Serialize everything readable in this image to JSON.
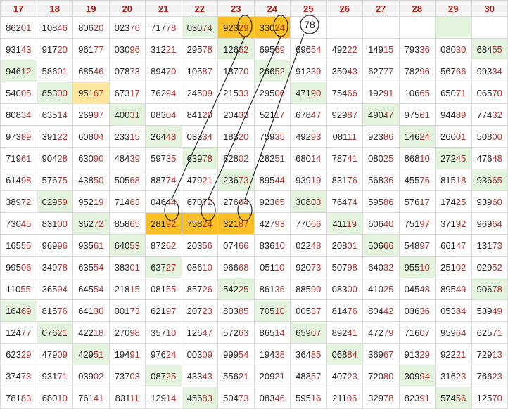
{
  "columns": [
    "17",
    "18",
    "19",
    "20",
    "21",
    "22",
    "23",
    "24",
    "25",
    "26",
    "27",
    "28",
    "29",
    "30"
  ],
  "rows": [
    [
      [
        "86201",
        ""
      ],
      [
        "10846",
        ""
      ],
      [
        "80620",
        ""
      ],
      [
        "02376",
        ""
      ],
      [
        "71778",
        ""
      ],
      [
        "03074",
        "g"
      ],
      [
        "92329",
        "o"
      ],
      [
        "33024",
        "o"
      ],
      [
        "",
        ""
      ],
      [
        "",
        ""
      ],
      [
        "",
        ""
      ],
      [
        "",
        ""
      ],
      [
        "",
        "g"
      ],
      [
        "",
        ""
      ]
    ],
    [
      [
        "93143",
        ""
      ],
      [
        "91720",
        ""
      ],
      [
        "96177",
        ""
      ],
      [
        "03096",
        ""
      ],
      [
        "31221",
        ""
      ],
      [
        "29578",
        ""
      ],
      [
        "12662",
        "g"
      ],
      [
        "69569",
        ""
      ],
      [
        "69654",
        ""
      ],
      [
        "49222",
        ""
      ],
      [
        "14915",
        ""
      ],
      [
        "79336",
        ""
      ],
      [
        "08030",
        ""
      ],
      [
        "68455",
        "g"
      ]
    ],
    [
      [
        "94612",
        "g"
      ],
      [
        "58601",
        ""
      ],
      [
        "68546",
        ""
      ],
      [
        "07873",
        ""
      ],
      [
        "89470",
        ""
      ],
      [
        "10587",
        ""
      ],
      [
        "18770",
        ""
      ],
      [
        "26652",
        "g"
      ],
      [
        "91239",
        ""
      ],
      [
        "35043",
        ""
      ],
      [
        "62777",
        ""
      ],
      [
        "78296",
        ""
      ],
      [
        "56766",
        ""
      ],
      [
        "99334",
        ""
      ]
    ],
    [
      [
        "54005",
        ""
      ],
      [
        "85300",
        "g"
      ],
      [
        "95167",
        "y"
      ],
      [
        "67317",
        ""
      ],
      [
        "76294",
        ""
      ],
      [
        "24509",
        ""
      ],
      [
        "21533",
        ""
      ],
      [
        "29506",
        ""
      ],
      [
        "47190",
        "g"
      ],
      [
        "75466",
        ""
      ],
      [
        "19291",
        ""
      ],
      [
        "10665",
        ""
      ],
      [
        "65071",
        ""
      ],
      [
        "06570",
        ""
      ]
    ],
    [
      [
        "80834",
        ""
      ],
      [
        "63514",
        ""
      ],
      [
        "26997",
        ""
      ],
      [
        "40031",
        "g"
      ],
      [
        "08304",
        ""
      ],
      [
        "84120",
        ""
      ],
      [
        "20433",
        ""
      ],
      [
        "52117",
        ""
      ],
      [
        "67847",
        ""
      ],
      [
        "92987",
        ""
      ],
      [
        "49047",
        "g"
      ],
      [
        "97561",
        ""
      ],
      [
        "94489",
        ""
      ],
      [
        "77432",
        ""
      ]
    ],
    [
      [
        "97389",
        ""
      ],
      [
        "39122",
        ""
      ],
      [
        "60804",
        ""
      ],
      [
        "23315",
        ""
      ],
      [
        "26443",
        "g"
      ],
      [
        "03334",
        ""
      ],
      [
        "18320",
        ""
      ],
      [
        "75935",
        ""
      ],
      [
        "49293",
        ""
      ],
      [
        "08111",
        ""
      ],
      [
        "92386",
        ""
      ],
      [
        "14624",
        "g"
      ],
      [
        "26001",
        ""
      ],
      [
        "50800",
        ""
      ]
    ],
    [
      [
        "71961",
        ""
      ],
      [
        "90428",
        ""
      ],
      [
        "63090",
        ""
      ],
      [
        "48439",
        ""
      ],
      [
        "59735",
        ""
      ],
      [
        "63978",
        "g"
      ],
      [
        "82802",
        ""
      ],
      [
        "28251",
        ""
      ],
      [
        "68014",
        ""
      ],
      [
        "78741",
        ""
      ],
      [
        "08025",
        ""
      ],
      [
        "86810",
        ""
      ],
      [
        "27245",
        "g"
      ],
      [
        "47648",
        ""
      ]
    ],
    [
      [
        "61498",
        ""
      ],
      [
        "57675",
        ""
      ],
      [
        "43850",
        ""
      ],
      [
        "50568",
        ""
      ],
      [
        "88774",
        ""
      ],
      [
        "47921",
        ""
      ],
      [
        "23673",
        "g"
      ],
      [
        "89544",
        ""
      ],
      [
        "93919",
        ""
      ],
      [
        "83176",
        ""
      ],
      [
        "56836",
        ""
      ],
      [
        "45576",
        ""
      ],
      [
        "81518",
        ""
      ],
      [
        "93665",
        "g"
      ]
    ],
    [
      [
        "38972",
        ""
      ],
      [
        "02959",
        "g"
      ],
      [
        "95219",
        ""
      ],
      [
        "71463",
        ""
      ],
      [
        "04644",
        ""
      ],
      [
        "67072",
        ""
      ],
      [
        "27664",
        ""
      ],
      [
        "92365",
        ""
      ],
      [
        "30803",
        "g"
      ],
      [
        "76474",
        ""
      ],
      [
        "59586",
        ""
      ],
      [
        "57617",
        ""
      ],
      [
        "17425",
        ""
      ],
      [
        "93960",
        ""
      ]
    ],
    [
      [
        "73045",
        ""
      ],
      [
        "83100",
        ""
      ],
      [
        "36272",
        "g"
      ],
      [
        "85865",
        ""
      ],
      [
        "28192",
        "o"
      ],
      [
        "75824",
        "o"
      ],
      [
        "32187",
        "o"
      ],
      [
        "42793",
        ""
      ],
      [
        "77066",
        ""
      ],
      [
        "41119",
        "g"
      ],
      [
        "60640",
        ""
      ],
      [
        "75197",
        ""
      ],
      [
        "37192",
        ""
      ],
      [
        "96964",
        ""
      ]
    ],
    [
      [
        "16555",
        ""
      ],
      [
        "96996",
        ""
      ],
      [
        "93561",
        ""
      ],
      [
        "64053",
        "g"
      ],
      [
        "87262",
        ""
      ],
      [
        "20356",
        ""
      ],
      [
        "07466",
        ""
      ],
      [
        "83610",
        ""
      ],
      [
        "02248",
        ""
      ],
      [
        "20801",
        ""
      ],
      [
        "50666",
        "g"
      ],
      [
        "54897",
        ""
      ],
      [
        "66147",
        ""
      ],
      [
        "13173",
        ""
      ]
    ],
    [
      [
        "99506",
        ""
      ],
      [
        "34978",
        ""
      ],
      [
        "63554",
        ""
      ],
      [
        "38301",
        ""
      ],
      [
        "63727",
        "g"
      ],
      [
        "08610",
        ""
      ],
      [
        "96668",
        ""
      ],
      [
        "05110",
        ""
      ],
      [
        "92073",
        ""
      ],
      [
        "50798",
        ""
      ],
      [
        "64032",
        ""
      ],
      [
        "95510",
        "g"
      ],
      [
        "25102",
        ""
      ],
      [
        "02952",
        ""
      ]
    ],
    [
      [
        "11055",
        ""
      ],
      [
        "36594",
        ""
      ],
      [
        "64554",
        ""
      ],
      [
        "21815",
        ""
      ],
      [
        "08155",
        ""
      ],
      [
        "85726",
        ""
      ],
      [
        "54225",
        "g"
      ],
      [
        "86136",
        ""
      ],
      [
        "88590",
        ""
      ],
      [
        "08300",
        ""
      ],
      [
        "41025",
        ""
      ],
      [
        "04548",
        ""
      ],
      [
        "89549",
        ""
      ],
      [
        "90678",
        "g"
      ]
    ],
    [
      [
        "16469",
        "g"
      ],
      [
        "81576",
        ""
      ],
      [
        "64130",
        ""
      ],
      [
        "00173",
        ""
      ],
      [
        "62197",
        ""
      ],
      [
        "20723",
        ""
      ],
      [
        "80385",
        ""
      ],
      [
        "70510",
        "g"
      ],
      [
        "00537",
        ""
      ],
      [
        "81476",
        ""
      ],
      [
        "80442",
        ""
      ],
      [
        "03636",
        ""
      ],
      [
        "05384",
        ""
      ],
      [
        "53949",
        ""
      ]
    ],
    [
      [
        "12477",
        ""
      ],
      [
        "07621",
        "g"
      ],
      [
        "42218",
        ""
      ],
      [
        "27098",
        ""
      ],
      [
        "35710",
        ""
      ],
      [
        "12647",
        ""
      ],
      [
        "57263",
        ""
      ],
      [
        "86514",
        ""
      ],
      [
        "65907",
        "g"
      ],
      [
        "89241",
        ""
      ],
      [
        "47279",
        ""
      ],
      [
        "71607",
        ""
      ],
      [
        "95964",
        ""
      ],
      [
        "62571",
        ""
      ]
    ],
    [
      [
        "62329",
        ""
      ],
      [
        "47909",
        ""
      ],
      [
        "42951",
        "g"
      ],
      [
        "19491",
        ""
      ],
      [
        "97624",
        ""
      ],
      [
        "00309",
        ""
      ],
      [
        "99954",
        ""
      ],
      [
        "19438",
        ""
      ],
      [
        "36485",
        ""
      ],
      [
        "06884",
        "g"
      ],
      [
        "36967",
        ""
      ],
      [
        "91329",
        ""
      ],
      [
        "92221",
        ""
      ],
      [
        "72913",
        ""
      ]
    ],
    [
      [
        "37473",
        ""
      ],
      [
        "93171",
        ""
      ],
      [
        "03902",
        ""
      ],
      [
        "73703",
        ""
      ],
      [
        "08725",
        "g"
      ],
      [
        "43343",
        ""
      ],
      [
        "55621",
        ""
      ],
      [
        "20921",
        ""
      ],
      [
        "48857",
        ""
      ],
      [
        "40723",
        ""
      ],
      [
        "72080",
        ""
      ],
      [
        "30994",
        "g"
      ],
      [
        "31623",
        ""
      ],
      [
        "76623",
        ""
      ]
    ],
    [
      [
        "78183",
        ""
      ],
      [
        "68010",
        ""
      ],
      [
        "76141",
        ""
      ],
      [
        "83111",
        ""
      ],
      [
        "12914",
        ""
      ],
      [
        "45683",
        "g"
      ],
      [
        "50473",
        ""
      ],
      [
        "08346",
        ""
      ],
      [
        "59516",
        ""
      ],
      [
        "21106",
        ""
      ],
      [
        "32978",
        ""
      ],
      [
        "82391",
        ""
      ],
      [
        "57456",
        "g"
      ],
      [
        "12570",
        ""
      ]
    ]
  ],
  "annotation": {
    "prediction": "78",
    "colors": {
      "green_cell": "#e3f3dd",
      "orange_cell": "#fbbf26",
      "yellow_cell": "#fde79c",
      "header_text": "#a8201a",
      "digit_text": "#a83232"
    }
  }
}
